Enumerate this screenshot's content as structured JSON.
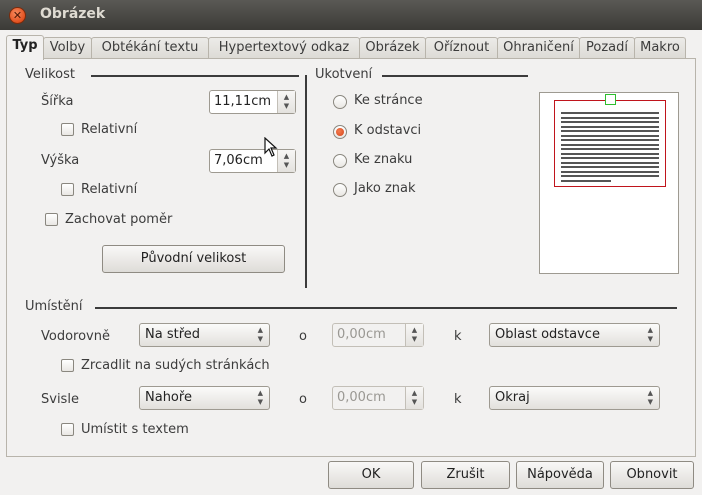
{
  "window": {
    "title": "Obrázek"
  },
  "tabs": [
    {
      "label": "Typ",
      "active": true
    },
    {
      "label": "Volby"
    },
    {
      "label": "Obtékání textu"
    },
    {
      "label": "Hypertextový odkaz"
    },
    {
      "label": "Obrázek"
    },
    {
      "label": "Oříznout"
    },
    {
      "label": "Ohraničení"
    },
    {
      "label": "Pozadí"
    },
    {
      "label": "Makro"
    }
  ],
  "size": {
    "section_title": "Velikost",
    "width_label": "Šířka",
    "width_value": "11,11cm",
    "width_relative_label": "Relativní",
    "height_label": "Výška",
    "height_value": "7,06cm",
    "height_relative_label": "Relativní",
    "keep_ratio_label": "Zachovat poměr",
    "original_size_button": "Původní velikost"
  },
  "anchor": {
    "section_title": "Ukotvení",
    "options": [
      {
        "label": "Ke stránce",
        "selected": false
      },
      {
        "label": "K odstavci",
        "selected": true
      },
      {
        "label": "Ke znaku",
        "selected": false
      },
      {
        "label": "Jako znak",
        "selected": false
      }
    ]
  },
  "position": {
    "section_title": "Umístění",
    "horizontal_label": "Vodorovně",
    "horizontal_value": "Na střed",
    "horizontal_by_label": "o",
    "horizontal_by_value": "0,00cm",
    "horizontal_to_label": "k",
    "horizontal_to_value": "Oblast odstavce",
    "mirror_label": "Zrcadlit na sudých stránkách",
    "vertical_label": "Svisle",
    "vertical_value": "Nahoře",
    "vertical_by_label": "o",
    "vertical_by_value": "0,00cm",
    "vertical_to_label": "k",
    "vertical_to_value": "Okraj",
    "follow_text_label": "Umístit s textem"
  },
  "buttons": {
    "ok": "OK",
    "cancel": "Zrušit",
    "help": "Nápověda",
    "reset": "Obnovit"
  },
  "colors": {
    "titlebar": "#3c3b37",
    "accent": "#e2501f",
    "preview_frame": "#c0141c",
    "preview_anchor": "#2ebd2e"
  }
}
